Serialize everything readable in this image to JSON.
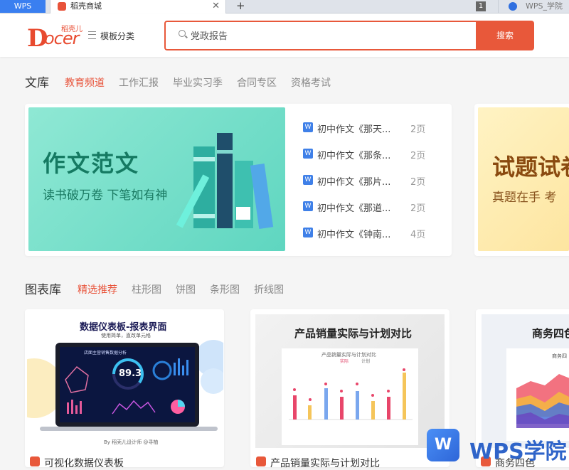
{
  "tabs": {
    "wps_label": "WPS",
    "active_title": "稻壳商城",
    "close": "✕",
    "new_tab": "+",
    "count": "1",
    "second_title": "WPS_学院"
  },
  "header": {
    "brand_d": "D",
    "brand_ocer": "ocer",
    "brand_cn": "稻壳儿",
    "menu_label": "模板分类",
    "search_value": "党政报告",
    "search_button": "搜索"
  },
  "wenku": {
    "title": "文库",
    "tabs": [
      "教育频道",
      "工作汇报",
      "毕业实习季",
      "合同专区",
      "资格考试"
    ],
    "banner_title": "作文范文",
    "banner_sub": "读书破万卷 下笔如有神",
    "docs": [
      {
        "icon": "W",
        "title": "初中作文《那天...",
        "pages": "2页"
      },
      {
        "icon": "W",
        "title": "初中作文《那条...",
        "pages": "2页"
      },
      {
        "icon": "W",
        "title": "初中作文《那片...",
        "pages": "2页"
      },
      {
        "icon": "W",
        "title": "初中作文《那道...",
        "pages": "2页"
      },
      {
        "icon": "W",
        "title": "初中作文《钟南...",
        "pages": "4页"
      }
    ],
    "banner2_title": "试题试卷",
    "banner2_sub": "真题在手 考"
  },
  "charts": {
    "title": "图表库",
    "tabs": [
      "精选推荐",
      "柱形图",
      "饼图",
      "条形图",
      "折线图"
    ],
    "cards": [
      {
        "title": "数据仪表板-报表界面",
        "sub": "使用简单，直改单元格",
        "screen_title": "店面主营销售数据分析",
        "screen_value": "89.3",
        "footer": "By 稻壳儿设计师 @寻柚",
        "label": "可视化数据仪表板"
      },
      {
        "title": "产品销量实际与计划对比",
        "inner_title": "产品销量实际与计划对比",
        "legend": [
          "实际",
          "计划"
        ],
        "label": "产品销量实际与计划对比"
      },
      {
        "title": "商务四色",
        "inner_title": "商务四",
        "label": "商务四色"
      }
    ]
  },
  "watermark": {
    "badge": "W",
    "text": "WPS学院"
  },
  "colors": {
    "accent": "#e8583a",
    "doc_blue": "#3f80e8"
  }
}
